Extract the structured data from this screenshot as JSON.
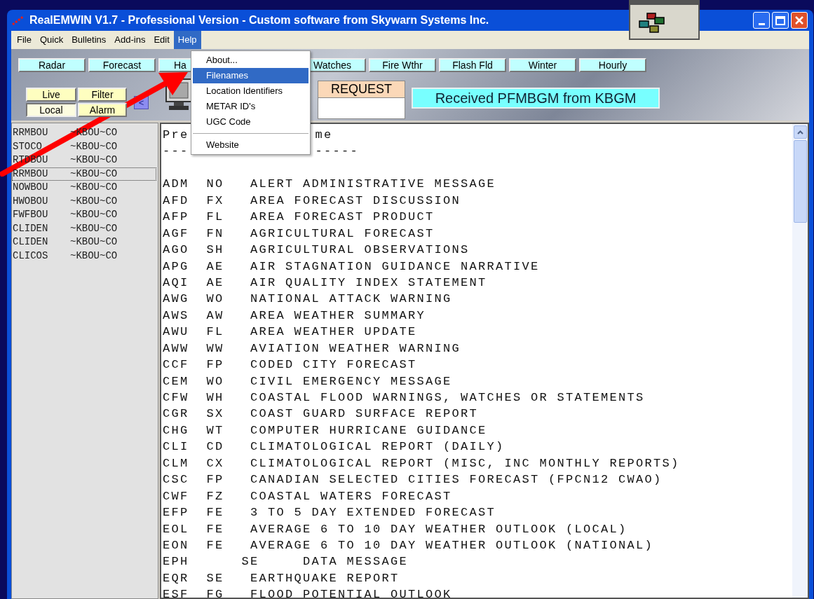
{
  "window": {
    "title": "RealEMWIN V1.7 - Professional Version - Custom software from Skywarn Systems Inc."
  },
  "menu_bar": [
    {
      "label": "File",
      "selected": false
    },
    {
      "label": "Quick",
      "selected": false
    },
    {
      "label": "Bulletins",
      "selected": false
    },
    {
      "label": "Add-ins",
      "selected": false
    },
    {
      "label": "Edit",
      "selected": false
    },
    {
      "label": "Help",
      "selected": true
    }
  ],
  "help_menu": {
    "groups": [
      [
        {
          "label": "About...",
          "selected": false
        },
        {
          "label": "Filenames",
          "selected": true
        },
        {
          "label": "Location Identifiers",
          "selected": false
        },
        {
          "label": "METAR ID's",
          "selected": false
        },
        {
          "label": "UGC Code",
          "selected": false
        }
      ],
      [
        {
          "label": "Website",
          "selected": false
        }
      ]
    ]
  },
  "toolbar_buttons": [
    {
      "label": "Radar",
      "kind": "button"
    },
    {
      "label": "Forecast",
      "kind": "button"
    },
    {
      "label": "Ha",
      "kind": "button"
    },
    {
      "kind": "hidden"
    },
    {
      "label": "Watches",
      "kind": "button"
    },
    {
      "label": "Fire Wthr",
      "kind": "button"
    },
    {
      "label": "Flash Fld",
      "kind": "button"
    },
    {
      "label": "Winter",
      "kind": "button"
    },
    {
      "label": "Hourly",
      "kind": "button"
    }
  ],
  "mode_buttons": [
    {
      "label": "Live",
      "selected": false
    },
    {
      "label": "Filter",
      "selected": false
    },
    {
      "label": "Local",
      "selected": true
    },
    {
      "label": "Alarm",
      "selected": false
    }
  ],
  "back_button": "<",
  "request": {
    "label": "REQUEST"
  },
  "status": "Received PFMBGM from KBGM",
  "product_list": [
    {
      "product": "RRMBOU",
      "source": "~KBOU~CO",
      "focused": false
    },
    {
      "product": "STOCO",
      "source": "~KBOU~CO",
      "focused": false
    },
    {
      "product": "RTDBOU",
      "source": "~KBOU~CO",
      "focused": false
    },
    {
      "product": "RRMBOU",
      "source": "~KBOU~CO",
      "focused": true
    },
    {
      "product": "NOWBOU",
      "source": "~KBOU~CO",
      "focused": false
    },
    {
      "product": "HWOBOU",
      "source": "~KBOU~CO",
      "focused": false
    },
    {
      "product": "FWFBOU",
      "source": "~KBOU~CO",
      "focused": false
    },
    {
      "product": "CLIDEN",
      "source": "~KBOU~CO",
      "focused": false
    },
    {
      "product": "CLIDEN",
      "source": "~KBOU~CO",
      "focused": false
    },
    {
      "product": "CLICOS",
      "source": "~KBOU~CO",
      "focused": false
    }
  ],
  "document": {
    "header": [
      "Pre",
      "me"
    ],
    "rule": [
      "---",
      "-----"
    ],
    "lines": [
      "ADM  NO   ALERT ADMINISTRATIVE MESSAGE",
      "AFD  FX   AREA FORECAST DISCUSSION",
      "AFP  FL   AREA FORECAST PRODUCT",
      "AGF  FN   AGRICULTURAL FORECAST",
      "AGO  SH   AGRICULTURAL OBSERVATIONS",
      "APG  AE   AIR STAGNATION GUIDANCE NARRATIVE",
      "AQI  AE   AIR QUALITY INDEX STATEMENT",
      "AWG  WO   NATIONAL ATTACK WARNING",
      "AWS  AW   AREA WEATHER SUMMARY",
      "AWU  FL   AREA WEATHER UPDATE",
      "AWW  WW   AVIATION WEATHER WARNING",
      "CCF  FP   CODED CITY FORECAST",
      "CEM  WO   CIVIL EMERGENCY MESSAGE",
      "CFW  WH   COASTAL FLOOD WARNINGS, WATCHES OR STATEMENTS",
      "CGR  SX   COAST GUARD SURFACE REPORT",
      "CHG  WT   COMPUTER HURRICANE GUIDANCE",
      "CLI  CD   CLIMATOLOGICAL REPORT (DAILY)",
      "CLM  CX   CLIMATOLOGICAL REPORT (MISC, INC MONTHLY REPORTS)",
      "CSC  FP   CANADIAN SELECTED CITIES FORECAST (FPCN12 CWAO)",
      "CWF  FZ   COASTAL WATERS FORECAST",
      "EFP  FE   3 TO 5 DAY EXTENDED FORECAST",
      "EOL  FE   AVERAGE 6 TO 10 DAY WEATHER OUTLOOK (LOCAL)",
      "EON  FE   AVERAGE 6 TO 10 DAY WEATHER OUTLOOK (NATIONAL)",
      "EPH      SE     DATA MESSAGE",
      "EQR  SE   EARTHQUAKE REPORT",
      "ESF  FG   FLOOD POTENTIAL OUTLOOK"
    ]
  }
}
